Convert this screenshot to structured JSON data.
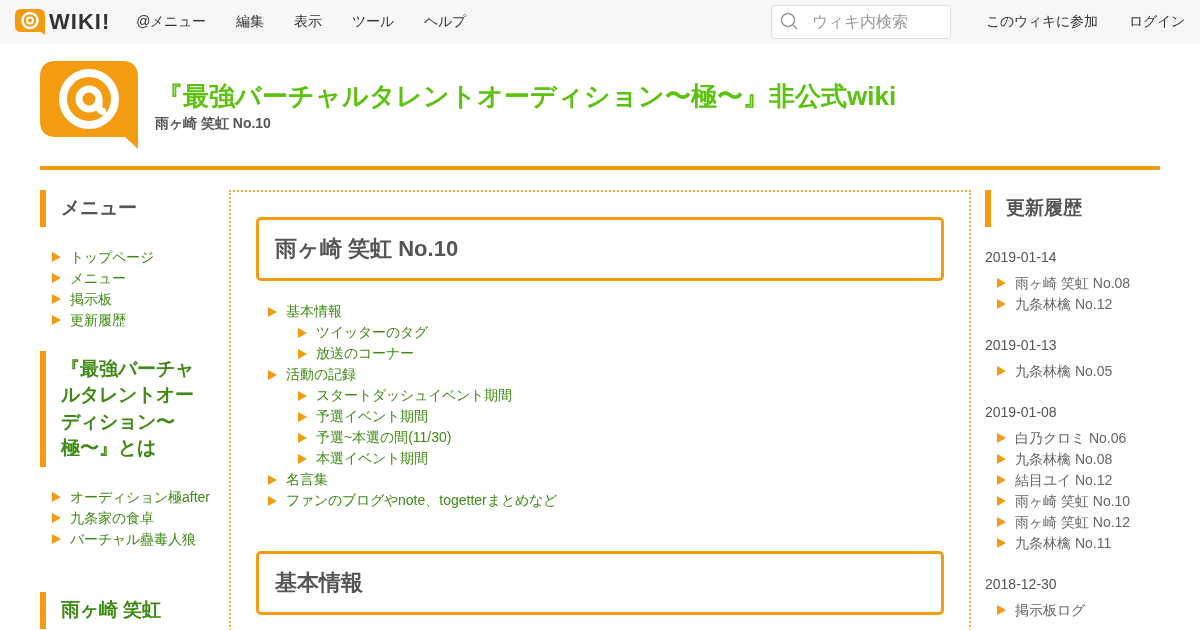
{
  "topbar": {
    "logo_text": "WIKI!",
    "menu": [
      "@メニュー",
      "編集",
      "表示",
      "ツール",
      "ヘルプ"
    ],
    "search": {
      "placeholder": "ウィキ内検索"
    },
    "links": [
      "このウィキに参加",
      "ログイン"
    ]
  },
  "header": {
    "title": "『最強バーチャルタレントオーディション〜極〜』非公式wiki",
    "subtitle": "雨ヶ崎 笑虹 No.10"
  },
  "left_sidebar": [
    {
      "heading": "メニュー",
      "kind": "plain",
      "items": [
        "トップページ",
        "メニュー",
        "掲示板",
        "更新履歴"
      ]
    },
    {
      "heading": "『最強バーチャルタレントオーディション〜極〜』とは",
      "kind": "link",
      "items": [
        "オーディション極after",
        "九条家の食卓",
        "バーチャル蠱毒人狼"
      ]
    },
    {
      "heading": "雨ヶ崎 笑虹",
      "kind": "link"
    }
  ],
  "main": {
    "page_title": "雨ヶ崎 笑虹 No.10",
    "toc": [
      {
        "label": "基本情報",
        "children": [
          {
            "label": "ツイッターのタグ"
          },
          {
            "label": "放送のコーナー"
          }
        ]
      },
      {
        "label": "活動の記録",
        "children": [
          {
            "label": "スタートダッシュイベント期間"
          },
          {
            "label": "予選イベント期間"
          },
          {
            "label": "予選~本選の間(11/30)"
          },
          {
            "label": "本選イベント期間"
          }
        ]
      },
      {
        "label": "名言集"
      },
      {
        "label": "ファンのブログやnote、togetterまとめなど"
      }
    ],
    "section_heading": "基本情報"
  },
  "right_sidebar": {
    "heading": "更新履歴",
    "groups": [
      {
        "date": "2019-01-14",
        "items": [
          "雨ヶ崎 笑虹 No.08",
          "九条林檎 No.12"
        ]
      },
      {
        "date": "2019-01-13",
        "items": [
          "九条林檎 No.05"
        ]
      },
      {
        "date": "2019-01-08",
        "items": [
          "白乃クロミ No.06",
          "九条林檎 No.08",
          "結目ユイ No.12",
          "雨ヶ崎 笑虹 No.10",
          "雨ヶ崎 笑虹 No.12",
          "九条林檎 No.11"
        ]
      },
      {
        "date": "2018-12-30",
        "items": [
          "掲示板ログ"
        ]
      }
    ]
  }
}
